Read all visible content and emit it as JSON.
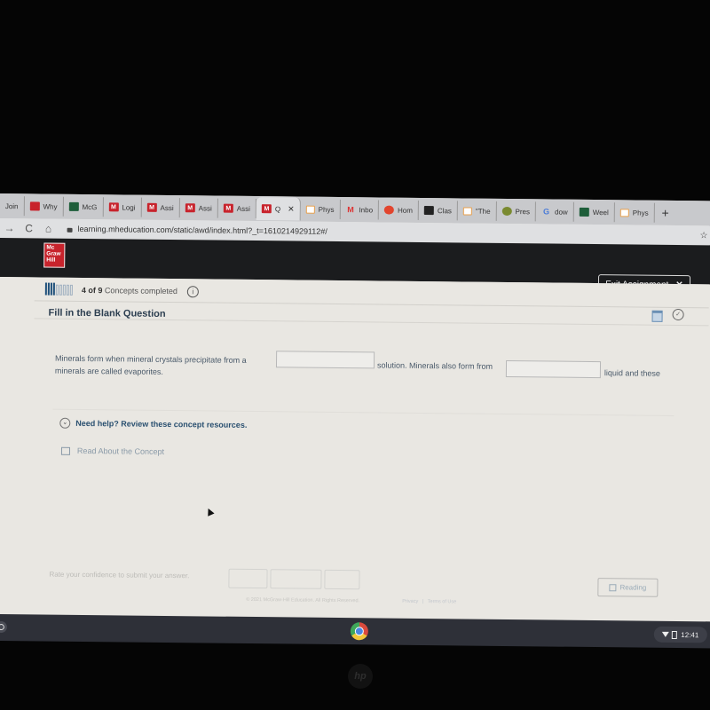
{
  "browser": {
    "tabs": [
      {
        "label": "Join",
        "icon": "none"
      },
      {
        "label": "Why",
        "icon": "red-person"
      },
      {
        "label": "McG",
        "icon": "green-person"
      },
      {
        "label": "Logi",
        "icon": "mh-m"
      },
      {
        "label": "Assi",
        "icon": "mh-m"
      },
      {
        "label": "Assi",
        "icon": "mh-m"
      },
      {
        "label": "Assi",
        "icon": "mh-m"
      },
      {
        "label": "Q",
        "icon": "mh-m",
        "active": true
      },
      {
        "label": "Phys",
        "icon": "orange-square"
      },
      {
        "label": "Inbo",
        "icon": "gmail-m"
      },
      {
        "label": "Hom",
        "icon": "red-circle"
      },
      {
        "label": "Clas",
        "icon": "dark-person"
      },
      {
        "label": "\"The",
        "icon": "orange-square"
      },
      {
        "label": "Pres",
        "icon": "green-drop"
      },
      {
        "label": "dow",
        "icon": "google-g"
      },
      {
        "label": "Weel",
        "icon": "green-person"
      },
      {
        "label": "Phys",
        "icon": "orange-square"
      }
    ],
    "mh_letter": "M",
    "close_glyph": "✕",
    "new_tab_glyph": "+",
    "back_glyph": "→",
    "reload_glyph": "C",
    "home_glyph": "⌂",
    "url": "learning.mheducation.com/static/awd/index.html?_t=1610214929112#/",
    "bookmark_glyph": "☆"
  },
  "app": {
    "logo_lines": [
      "Mc",
      "Graw",
      "Hill"
    ],
    "exit_button": "Exit Assignment",
    "exit_glyph": "✕",
    "progress": {
      "completed": 4,
      "total": 9,
      "count_text": "4 of 9",
      "suffix": "Concepts completed"
    },
    "info_glyph": "i",
    "question_title": "Fill in the Blank Question",
    "check_glyph": "✓",
    "question": {
      "part1": "Minerals form when mineral crystals precipitate from a",
      "part2": "solution. Minerals also form from",
      "part3": "liquid and these",
      "part4": "minerals are called evaporites.",
      "blank1_value": "",
      "blank2_value": ""
    },
    "help": {
      "chevron_glyph": "⌄",
      "text": "Need help? Review these concept resources."
    },
    "read_concept": "Read About the Concept",
    "footer": {
      "rate_text": "Rate your confidence to submit your answer.",
      "reading_button": "Reading",
      "copyright": "© 2021 McGraw-Hill Education. All Rights Reserved.",
      "privacy": "Privacy",
      "separator": "|",
      "terms": "Terms of Use"
    }
  },
  "os": {
    "clock": "12:41",
    "brand": "hp"
  }
}
